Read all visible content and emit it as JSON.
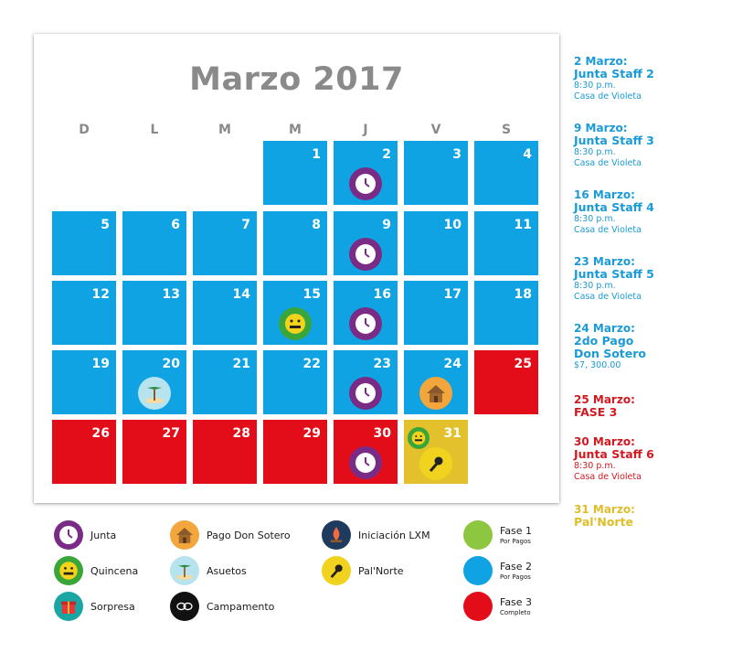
{
  "calendar": {
    "title": "Marzo 2017",
    "weekdays": [
      "D",
      "L",
      "M",
      "M",
      "J",
      "V",
      "S"
    ],
    "days": {
      "d1": "1",
      "d2": "2",
      "d3": "3",
      "d4": "4",
      "d5": "5",
      "d6": "6",
      "d7": "7",
      "d8": "8",
      "d9": "9",
      "d10": "10",
      "d11": "11",
      "d12": "12",
      "d13": "13",
      "d14": "14",
      "d15": "15",
      "d16": "16",
      "d17": "17",
      "d18": "18",
      "d19": "19",
      "d20": "20",
      "d21": "21",
      "d22": "22",
      "d23": "23",
      "d24": "24",
      "d25": "25",
      "d26": "26",
      "d27": "27",
      "d28": "28",
      "d29": "29",
      "d30": "30",
      "d31": "31"
    },
    "colors": {
      "fase1": "#8dc63f",
      "fase2": "#0fa3e4",
      "fase3": "#e20d18",
      "palnorte": "#e2c12c",
      "junta": "#7a2b86"
    }
  },
  "legend": {
    "junta": "Junta",
    "quincena": "Quincena",
    "sorpresa": "Sorpresa",
    "pago_don_sotero": "Pago Don Sotero",
    "asuetos": "Asuetos",
    "campamento": "Campamento",
    "iniciacion": "Iniciación LXM",
    "palnorte": "Pal'Norte",
    "fase1": "Fase 1",
    "fase1_sub": "Por Pagos",
    "fase2": "Fase 2",
    "fase2_sub": "Por Pagos",
    "fase3": "Fase 3",
    "fase3_sub": "Completo"
  },
  "events": [
    {
      "date": "2 Marzo:",
      "title": "Junta Staff 2",
      "time": "8:30 p.m.",
      "place": "Casa de Violeta"
    },
    {
      "date": "9 Marzo:",
      "title": "Junta Staff 3",
      "time": "8:30 p.m.",
      "place": "Casa de Violeta"
    },
    {
      "date": "16 Marzo:",
      "title": "Junta Staff 4",
      "time": "8:30 p.m.",
      "place": "Casa de Violeta"
    },
    {
      "date": "23 Marzo:",
      "title": "Junta Staff 5",
      "time": "8:30 p.m.",
      "place": "Casa de Violeta"
    },
    {
      "date": "24 Marzo:",
      "title": "2do Pago",
      "title2": "Don Sotero",
      "amount": "$7, 300.00"
    },
    {
      "date": "25 Marzo:",
      "title": "FASE 3"
    },
    {
      "date": "30 Marzo:",
      "title": "Junta Staff 6",
      "time": "8:30 p.m.",
      "place": "Casa de Violeta"
    },
    {
      "date": "31 Marzo:",
      "title": "Pal'Norte"
    }
  ]
}
